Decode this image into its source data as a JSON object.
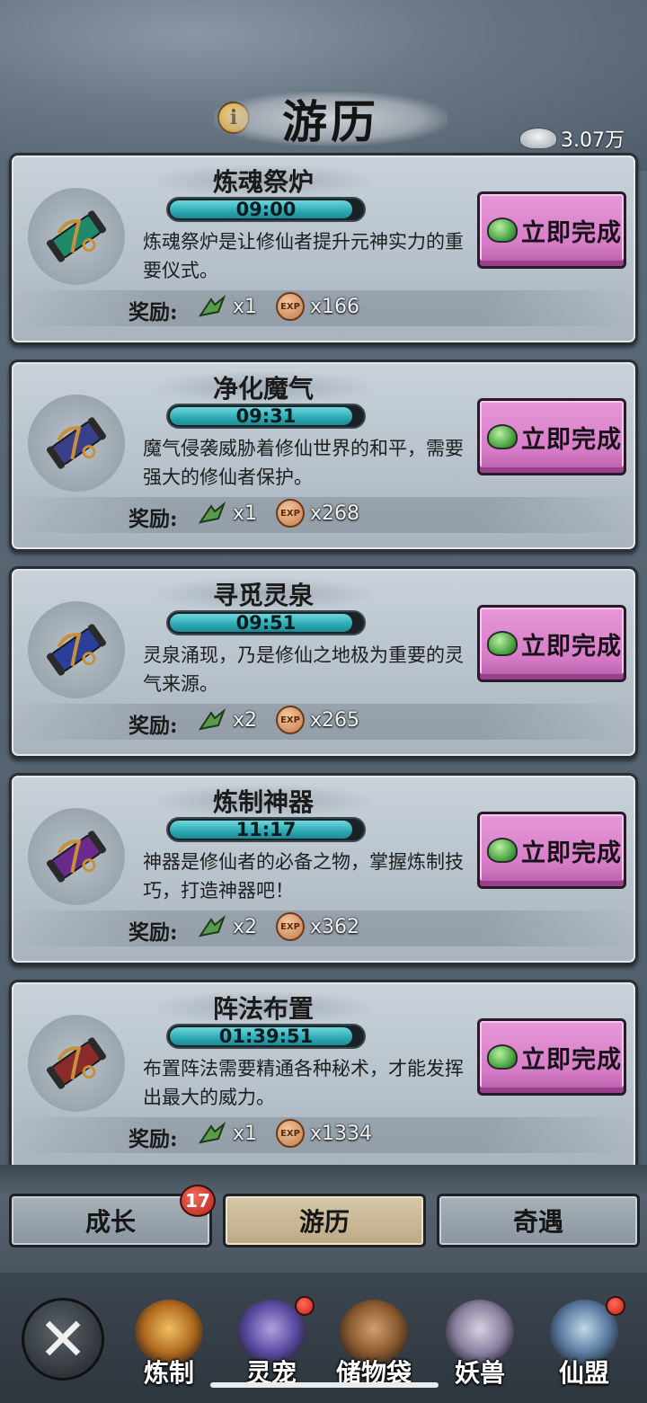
{
  "header": {
    "title": "游历",
    "currency_value": "3.07万"
  },
  "tasks": [
    {
      "name": "炼魂祭炉",
      "timer": "09:00",
      "timer_fill": 0.95,
      "description": "炼魂祭炉是让修仙者提升元神实力的重要仪式。",
      "reward_label": "奖励:",
      "item_count": "x1",
      "exp_count": "x166",
      "button_label": "立即完成",
      "scroll_color": "#1f8a6a"
    },
    {
      "name": "净化魔气",
      "timer": "09:31",
      "timer_fill": 0.95,
      "description": "魔气侵袭威胁着修仙世界的和平，需要强大的修仙者保护。",
      "reward_label": "奖励:",
      "item_count": "x1",
      "exp_count": "x268",
      "button_label": "立即完成",
      "scroll_color": "#3a3f8a"
    },
    {
      "name": "寻觅灵泉",
      "timer": "09:51",
      "timer_fill": 0.95,
      "description": "灵泉涌现，乃是修仙之地极为重要的灵气来源。",
      "reward_label": "奖励:",
      "item_count": "x2",
      "exp_count": "x265",
      "button_label": "立即完成",
      "scroll_color": "#2a3f9a"
    },
    {
      "name": "炼制神器",
      "timer": "11:17",
      "timer_fill": 0.95,
      "description": "神器是修仙者的必备之物，掌握炼制技巧，打造神器吧！",
      "reward_label": "奖励:",
      "item_count": "x2",
      "exp_count": "x362",
      "button_label": "立即完成",
      "scroll_color": "#6a2a8a"
    },
    {
      "name": "阵法布置",
      "timer": "01:39:51",
      "timer_fill": 0.95,
      "description": "布置阵法需要精通各种秘术，才能发挥出最大的威力。",
      "reward_label": "奖励:",
      "item_count": "x1",
      "exp_count": "x1334",
      "button_label": "立即完成",
      "scroll_color": "#8a2a2a"
    }
  ],
  "tabs": [
    {
      "label": "成长",
      "badge": "17"
    },
    {
      "label": "游历"
    },
    {
      "label": "奇遇"
    }
  ],
  "bottom_nav": [
    {
      "label": "炼制"
    },
    {
      "label": "灵宠"
    },
    {
      "label": "储物袋"
    },
    {
      "label": "妖兽"
    },
    {
      "label": "仙盟"
    }
  ],
  "colors": {
    "button_pink": "#d67cc7",
    "timer_cyan": "#2ba9b3",
    "active_tab": "#bda987"
  }
}
